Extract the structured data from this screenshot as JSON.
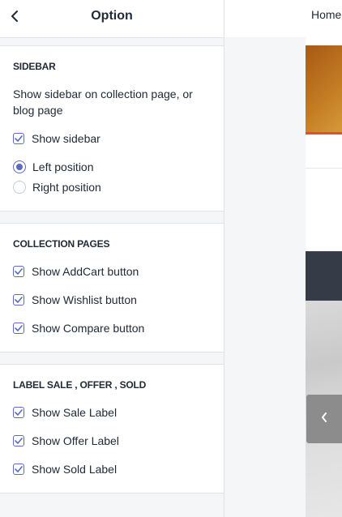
{
  "panel": {
    "title": "Option",
    "sections": [
      {
        "heading": "SIDEBAR",
        "description": "Show sidebar on collection page, or blog page",
        "checkbox_label": "Show sidebar",
        "radios": [
          "Left position",
          "Right position"
        ],
        "selected_radio": "Left position"
      },
      {
        "heading": "COLLECTION PAGES",
        "checkboxes": [
          "Show AddCart button",
          "Show Wishlist button",
          "Show Compare button"
        ]
      },
      {
        "heading": "LABEL SALE , OFFER , SOLD",
        "checkboxes": [
          "Show Sale Label",
          "Show Offer Label",
          "Show Sold Label"
        ]
      }
    ]
  },
  "preview": {
    "nav_home": "Home"
  },
  "icons": {
    "back": "chevron-left-icon",
    "check": "checkmark-icon",
    "slider_prev": "chevron-left-icon"
  },
  "colors": {
    "accent": "#5c6ac4",
    "panel_bg": "#f4f6f8",
    "hero": "#b8681c",
    "hero_line": "#e34b3f",
    "dark_bar": "#363b48"
  }
}
